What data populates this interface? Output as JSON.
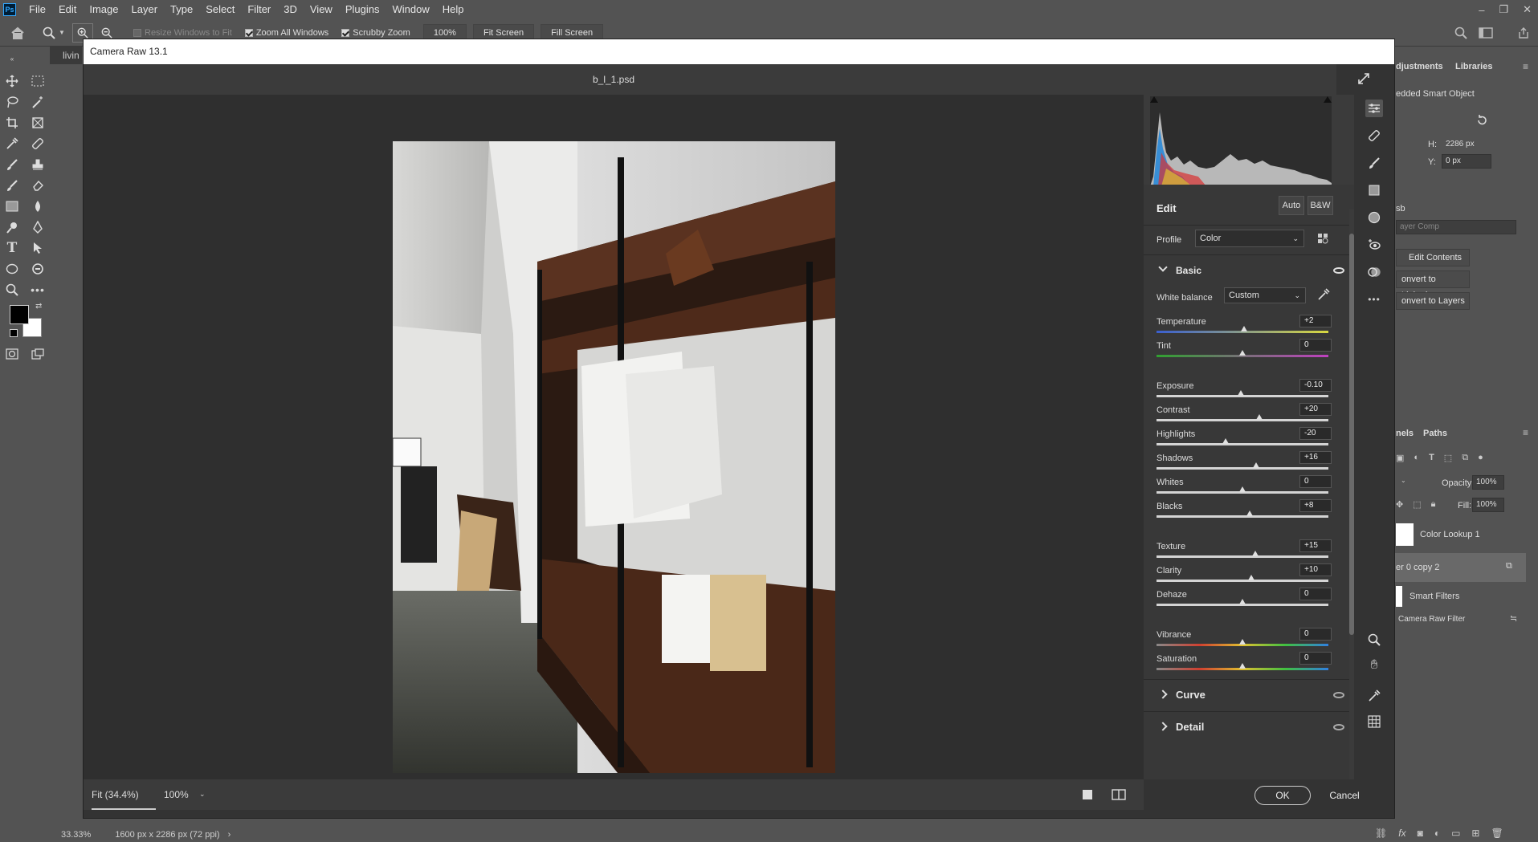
{
  "menubar": {
    "logo": "Ps",
    "items": [
      "File",
      "Edit",
      "Image",
      "Layer",
      "Type",
      "Select",
      "Filter",
      "3D",
      "View",
      "Plugins",
      "Window",
      "Help"
    ]
  },
  "options_bar": {
    "resize_windows": "Resize Windows to Fit",
    "zoom_all": "Zoom All Windows",
    "scrubby_zoom": "Scrubby Zoom",
    "zoom_value": "100%",
    "fit_screen": "Fit Screen",
    "fill_screen": "Fill Screen"
  },
  "document": {
    "tab_label": "livin"
  },
  "status_bar": {
    "zoom": "33.33%",
    "doc_info": "1600 px x 2286 px (72 ppi)"
  },
  "right_panel": {
    "tabs": [
      "djustments",
      "Libraries"
    ],
    "smart_object_label": "edded Smart Object",
    "h_label": "H:",
    "h_value": "2286 px",
    "y_label": "Y:",
    "y_value": "0 px",
    "sb_label": "sb",
    "layer_comp": "ayer Comp",
    "edit_contents": "Edit Contents",
    "convert_linked": "onvert to Linked...",
    "convert_layers": "onvert to Layers",
    "lower_tabs": [
      "nels",
      "Paths"
    ],
    "opacity_label": "Opacity:",
    "opacity_value": "100%",
    "fill_label": "Fill:",
    "fill_value": "100%",
    "layers": [
      "Color Lookup 1",
      "er 0 copy 2",
      "Smart Filters",
      "Camera Raw Filter"
    ]
  },
  "acr": {
    "title": "Camera Raw 13.1",
    "filename": "b_l_1.psd",
    "zoom_fit": "Fit (34.4%)",
    "zoom_pct": "100%",
    "ok": "OK",
    "cancel": "Cancel",
    "edit_label": "Edit",
    "auto": "Auto",
    "bw": "B&W",
    "profile_label": "Profile",
    "profile_value": "Color",
    "basic_label": "Basic",
    "wb_label": "White balance",
    "wb_value": "Custom",
    "sliders": [
      {
        "label": "Temperature",
        "value": "+2",
        "pos": 0.51
      },
      {
        "label": "Tint",
        "value": "0",
        "pos": 0.5
      },
      {
        "label": "Exposure",
        "value": "-0.10",
        "pos": 0.49
      },
      {
        "label": "Contrast",
        "value": "+20",
        "pos": 0.6
      },
      {
        "label": "Highlights",
        "value": "-20",
        "pos": 0.4
      },
      {
        "label": "Shadows",
        "value": "+16",
        "pos": 0.58
      },
      {
        "label": "Whites",
        "value": "0",
        "pos": 0.5
      },
      {
        "label": "Blacks",
        "value": "+8",
        "pos": 0.54
      },
      {
        "label": "Texture",
        "value": "+15",
        "pos": 0.575
      },
      {
        "label": "Clarity",
        "value": "+10",
        "pos": 0.55
      },
      {
        "label": "Dehaze",
        "value": "0",
        "pos": 0.5
      },
      {
        "label": "Vibrance",
        "value": "0",
        "pos": 0.5
      },
      {
        "label": "Saturation",
        "value": "0",
        "pos": 0.5
      }
    ],
    "curve_label": "Curve",
    "detail_label": "Detail"
  }
}
